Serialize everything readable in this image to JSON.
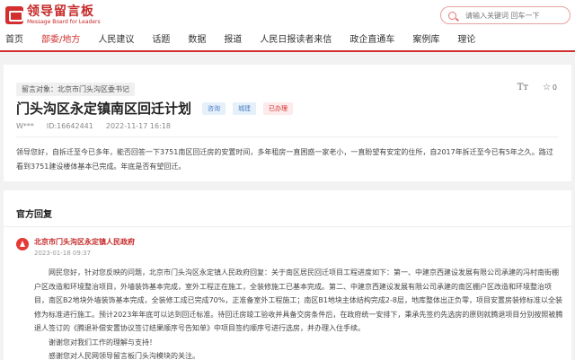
{
  "header": {
    "logo_cn": "领导留言板",
    "logo_en": "Message Board for Leaders",
    "search_placeholder": "请输入关键词 回车一下"
  },
  "nav": {
    "items": [
      {
        "label": "首页"
      },
      {
        "label": "部委/地方"
      },
      {
        "label": "人民建议"
      },
      {
        "label": "话题"
      },
      {
        "label": "数据"
      },
      {
        "label": "报道"
      },
      {
        "label": "人民日报读者来信"
      },
      {
        "label": "政企直通车"
      },
      {
        "label": "案例库"
      },
      {
        "label": "理论"
      }
    ],
    "active_index": 1
  },
  "message": {
    "target": "留言对象：北京市门头沟区委书记",
    "font_icon_label": "Tт",
    "star_count": "0",
    "title": "门头沟区永定镇南区回迁计划",
    "tags": [
      "咨询",
      "城建",
      "已办理"
    ],
    "author": "W***",
    "id": "ID:16642441",
    "time": "2022-11-17 16:18",
    "body": "领导您好，自拆迁至今已多年，能否回答一下3751南区回迁房的安置时间，多年租房一直困惑一家老小，一直盼望有安定的住所，自2017年拆迁至今已有5年之久。路过看到3751建设楼体基本已完成。年底是否有望回迁。"
  },
  "reply": {
    "heading": "官方回复",
    "org_name": "北京市门头沟区永定镇人民政府",
    "org_date": "2023-01-18 09:37",
    "para1": "网民您好，针对您反映的问题，北京市门头沟区永定镇人民政府回复：关于南区居民回迁项目工程进度如下：第一、中建京西建设发展有限公司承建的冯村南街棚户区改造和环境整治项目，外墙装饰基本完成，室外工程正在施工，全装修施工已基本完成。第二、中建京西建设发展有限公司承建的南区棚户区改造和环境整治项目，南区B2地块外墙装饰基本完成，全装修工成已完成70%，正准备室外工程施工；南区B1地块主体结构完成2-8层，地库整体出正负零，项目安置房装修标准以全装修为标准进行施工。预计2023年年底可以达到回迁标准。待回迁房竣工验收并具备交房条件后，在政府统一安排下，秉承先签约先选房的原则就腾退项目分别按照被腾退人签订的《腾退补偿安置协议签订结果顺序号告知单》中项目签约顺序号进行选房，并办理入住手续。",
    "para2": "谢谢您对我们工作的理解与支持！",
    "para3": "感谢您对人民网领导留言板门头沟模块的关注。"
  }
}
